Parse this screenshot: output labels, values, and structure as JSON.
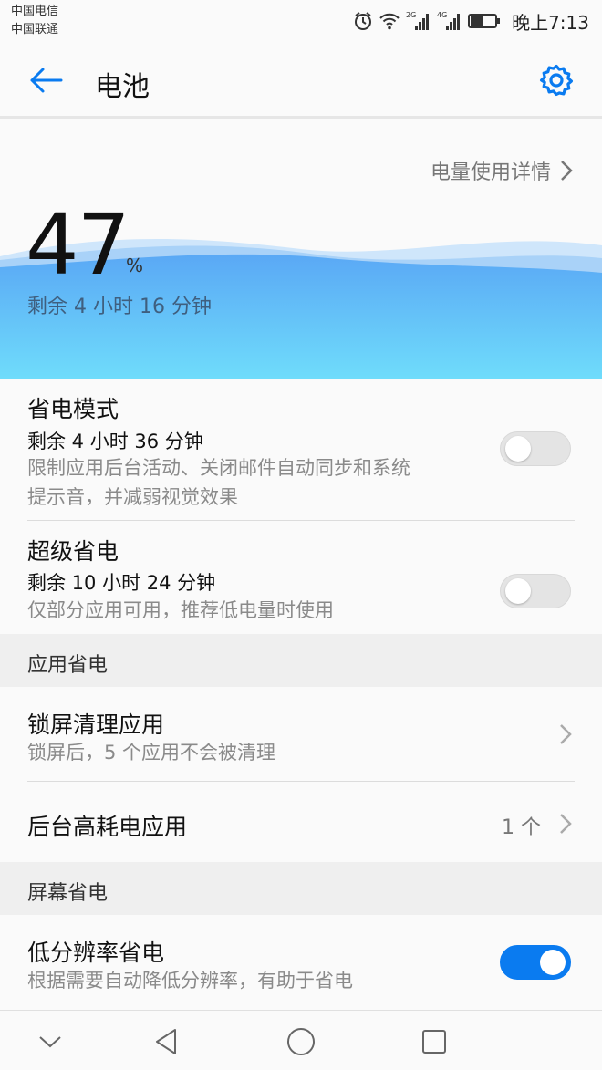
{
  "status_bar": {
    "carrier_1": "中国电信",
    "carrier_2": "中国联通",
    "signal_1_label": "2G",
    "signal_2_label": "4G",
    "time": "晚上7:13",
    "icons": [
      "alarm-icon",
      "wifi-icon",
      "signal-icon",
      "signal-icon",
      "battery-icon"
    ]
  },
  "app_bar": {
    "title": "电池",
    "back_icon": "arrow-left-icon",
    "settings_icon": "gear-icon",
    "accent_color": "#0a7bf0"
  },
  "battery": {
    "usage_details_label": "电量使用详情",
    "percent": "47",
    "percent_sign": "%",
    "remaining": "剩余 4 小时 16 分钟",
    "wave_color": "#5ab0f8"
  },
  "power_saving": {
    "title": "省电模式",
    "remaining": "剩余 4 小时 36 分钟",
    "description_line1": "限制应用后台活动、关闭邮件自动同步和系统",
    "description_line2": "提示音，并减弱视觉效果",
    "enabled": false
  },
  "ultra_power_saving": {
    "title": "超级省电",
    "remaining": "剩余 10 小时 24 分钟",
    "description": "仅部分应用可用，推荐低电量时使用",
    "enabled": false
  },
  "app_power_section": {
    "header": "应用省电",
    "lockscreen_cleanup": {
      "title": "锁屏清理应用",
      "subtitle": "锁屏后，5 个应用不会被清理"
    },
    "background_high_drain": {
      "title": "后台高耗电应用",
      "count": "1 个"
    }
  },
  "screen_power_section": {
    "header": "屏幕省电",
    "low_resolution": {
      "title": "低分辨率省电",
      "subtitle": "根据需要自动降低分辨率，有助于省电",
      "enabled": true
    }
  },
  "nav_bar": {
    "icons": [
      "chevron-down-icon",
      "back-triangle-icon",
      "home-circle-icon",
      "recents-square-icon"
    ]
  }
}
